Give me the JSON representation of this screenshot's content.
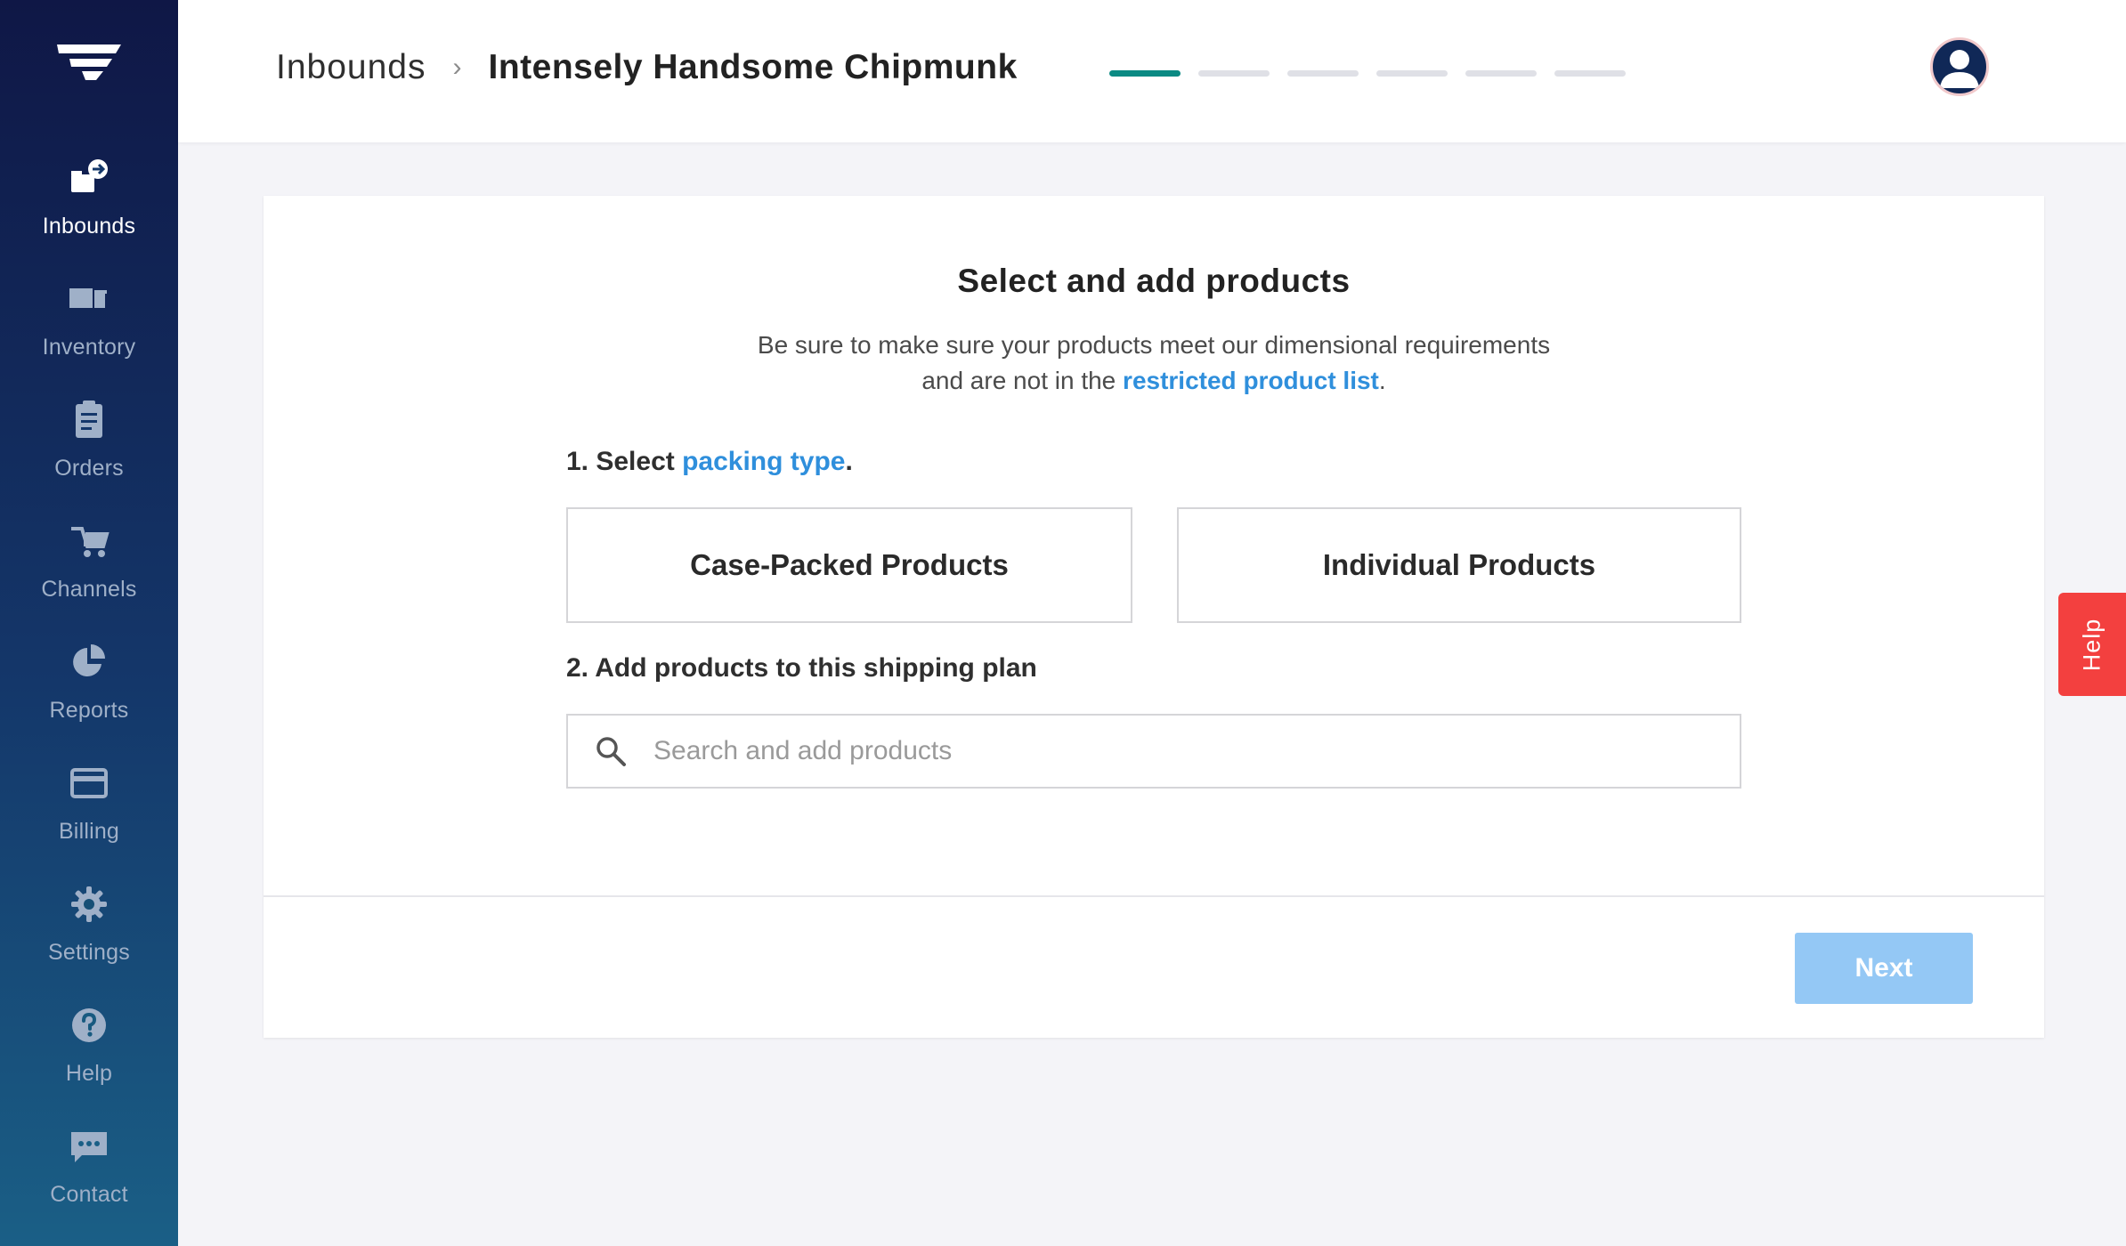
{
  "sidebar": {
    "items": [
      {
        "label": "Inbounds",
        "icon": "inbounds-icon",
        "active": true
      },
      {
        "label": "Inventory",
        "icon": "inventory-icon",
        "active": false
      },
      {
        "label": "Orders",
        "icon": "orders-icon",
        "active": false
      },
      {
        "label": "Channels",
        "icon": "channels-icon",
        "active": false
      },
      {
        "label": "Reports",
        "icon": "reports-icon",
        "active": false
      },
      {
        "label": "Billing",
        "icon": "billing-icon",
        "active": false
      },
      {
        "label": "Settings",
        "icon": "gear-icon",
        "active": false
      },
      {
        "label": "Help",
        "icon": "question-icon",
        "active": false
      },
      {
        "label": "Contact",
        "icon": "chat-icon",
        "active": false
      }
    ]
  },
  "header": {
    "breadcrumb_root": "Inbounds",
    "breadcrumb_separator": "›",
    "breadcrumb_current": "Intensely Handsome Chipmunk",
    "progress": {
      "current_step": 1,
      "total_steps": 6
    }
  },
  "card": {
    "title": "Select and add products",
    "subtitle_part1": "Be sure to make sure your products meet our dimensional requirements and are not in the",
    "subtitle_link": "restricted product list",
    "subtitle_end": ".",
    "step1_prefix": "1. Select",
    "step1_link": "packing type",
    "step1_end": ".",
    "packing_options": [
      "Case-Packed Products",
      "Individual Products"
    ],
    "step2_label": "2. Add products to this shipping plan",
    "search_placeholder": "Search and add products",
    "next_label": "Next"
  },
  "help_tab": {
    "label": "Help"
  },
  "colors": {
    "accent_teal": "#0b8a83",
    "link_blue": "#2f8fdc",
    "next_disabled": "#94c8f5",
    "help_red": "#f3403f",
    "sidebar_top": "#0f1746",
    "sidebar_bottom": "#1a5f86"
  }
}
